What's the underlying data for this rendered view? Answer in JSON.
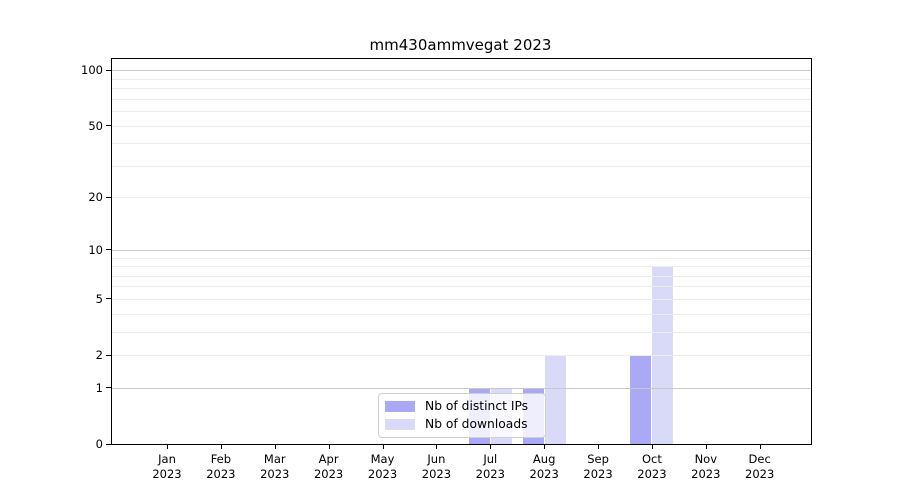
{
  "chart_data": {
    "type": "bar",
    "title": "mm430ammvegat 2023",
    "categories": [
      "Jan 2023",
      "Feb 2023",
      "Mar 2023",
      "Apr 2023",
      "May 2023",
      "Jun 2023",
      "Jul 2023",
      "Aug 2023",
      "Sep 2023",
      "Oct 2023",
      "Nov 2023",
      "Dec 2023"
    ],
    "series": [
      {
        "name": "Nb of distinct IPs",
        "color": "#a9a9f6",
        "values": [
          0,
          0,
          0,
          0,
          0,
          0,
          1,
          1,
          0,
          2,
          0,
          0
        ]
      },
      {
        "name": "Nb of downloads",
        "color": "#d9d9f8",
        "values": [
          0,
          0,
          0,
          0,
          0,
          0,
          1,
          2,
          0,
          8,
          0,
          0
        ]
      }
    ],
    "y_axis": {
      "scale": "log10(1+v)",
      "ticks": [
        0,
        1,
        2,
        5,
        10,
        20,
        50,
        100
      ],
      "max": 115,
      "minor_gridlines": [
        2,
        3,
        4,
        5,
        6,
        7,
        8,
        9,
        20,
        30,
        40,
        50,
        60,
        70,
        80,
        90
      ],
      "major_gridlines": [
        1,
        10,
        100
      ]
    },
    "legend_position": "lower center",
    "grid": true
  }
}
